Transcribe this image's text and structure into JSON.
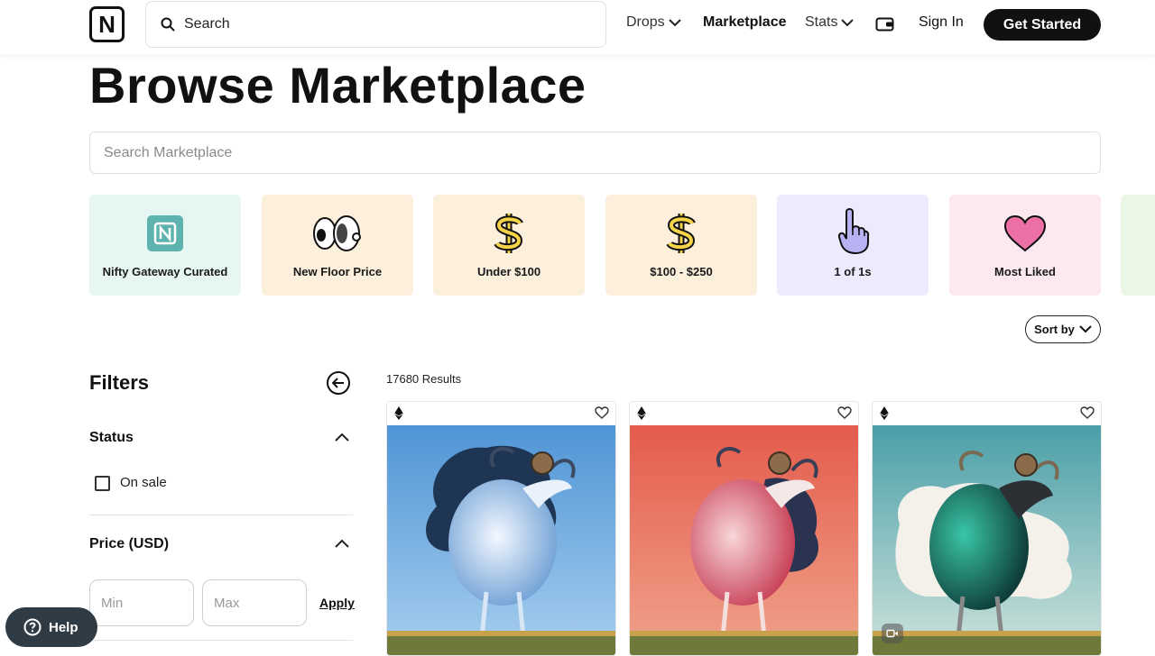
{
  "header": {
    "logo_letter": "N",
    "search_placeholder": "Search",
    "nav": {
      "drops": "Drops",
      "marketplace": "Marketplace",
      "stats": "Stats",
      "sign_in": "Sign In",
      "get_started": "Get Started"
    }
  },
  "page": {
    "title": "Browse Marketplace",
    "search_placeholder": "Search Marketplace"
  },
  "categories": [
    {
      "label": "Nifty Gateway Curated",
      "bg": "#e6f6f3",
      "icon": "nifty-logo-icon"
    },
    {
      "label": "New Floor Price",
      "bg": "#fcefdc",
      "icon": "eyes-icon"
    },
    {
      "label": "Under $100",
      "bg": "#fcefdc",
      "icon": "dollar-icon"
    },
    {
      "label": "$100 - $250",
      "bg": "#fcefdc",
      "icon": "dollar-icon"
    },
    {
      "label": "1 of 1s",
      "bg": "#ecebfd",
      "icon": "pointing-finger-icon"
    },
    {
      "label": "Most Liked",
      "bg": "#fbe8f1",
      "icon": "heart-icon"
    }
  ],
  "sort": {
    "label": "Sort by"
  },
  "filters": {
    "title": "Filters",
    "status": {
      "title": "Status",
      "options": [
        {
          "label": "On sale",
          "checked": false
        }
      ]
    },
    "price": {
      "title": "Price (USD)",
      "min_placeholder": "Min",
      "max_placeholder": "Max",
      "apply": "Apply"
    }
  },
  "results": {
    "count_text": "17680 Results"
  },
  "items": [
    {
      "currency_icon": "ethereum-icon",
      "liked": false,
      "palette": "blue",
      "video": false
    },
    {
      "currency_icon": "ethereum-icon",
      "liked": false,
      "palette": "red",
      "video": false
    },
    {
      "currency_icon": "ethereum-icon",
      "liked": false,
      "palette": "teal",
      "video": true
    }
  ],
  "help": {
    "label": "Help"
  }
}
